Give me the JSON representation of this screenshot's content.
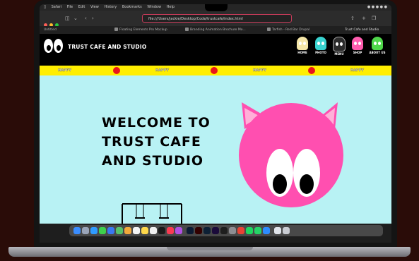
{
  "browser": {
    "menubar_items": [
      "Safari",
      "File",
      "Edit",
      "View",
      "History",
      "Bookmarks",
      "Window",
      "Help"
    ],
    "address_url": "file:///Users/jackie/Desktop/Code/trustcafe/index.html",
    "tabs": [
      "Untitled",
      "Floating Elements Pro Mockup",
      "Branding Animation Brochure Mo...",
      "Tarfish - Red Bar Drupal",
      "Trust Cafe and Studio"
    ]
  },
  "site": {
    "brand": "TRUST CAFE AND STUDIO",
    "nav": [
      {
        "label": "HOME",
        "color": "#f5e6a8"
      },
      {
        "label": "PHOTO",
        "color": "#39d3d0"
      },
      {
        "label": "MENU",
        "color": "#2b2b2b"
      },
      {
        "label": "SHOP",
        "color": "#ff5cae"
      },
      {
        "label": "ABOUT US",
        "color": "#4fd64a"
      }
    ],
    "ticker_word": "HAPPY",
    "hero_title": "WELCOME TO TRUST CAFE AND STUDIO"
  },
  "colors": {
    "hero_bg": "#b8f2f4",
    "ticker_bg": "#ffee00",
    "ticker_dot": "#e8141b",
    "mascot": "#ff4fb0"
  },
  "dock_apps": [
    "finder",
    "launchpad",
    "safari",
    "messages",
    "mail",
    "maps",
    "photos",
    "calendar",
    "notes",
    "reminders",
    "tv",
    "music",
    "podcasts",
    "photoshop",
    "illustrator",
    "lightroom",
    "aftereffects",
    "figma",
    "settings",
    "chrome",
    "spotify",
    "whatsapp",
    "zoom",
    "preview",
    "trash"
  ]
}
